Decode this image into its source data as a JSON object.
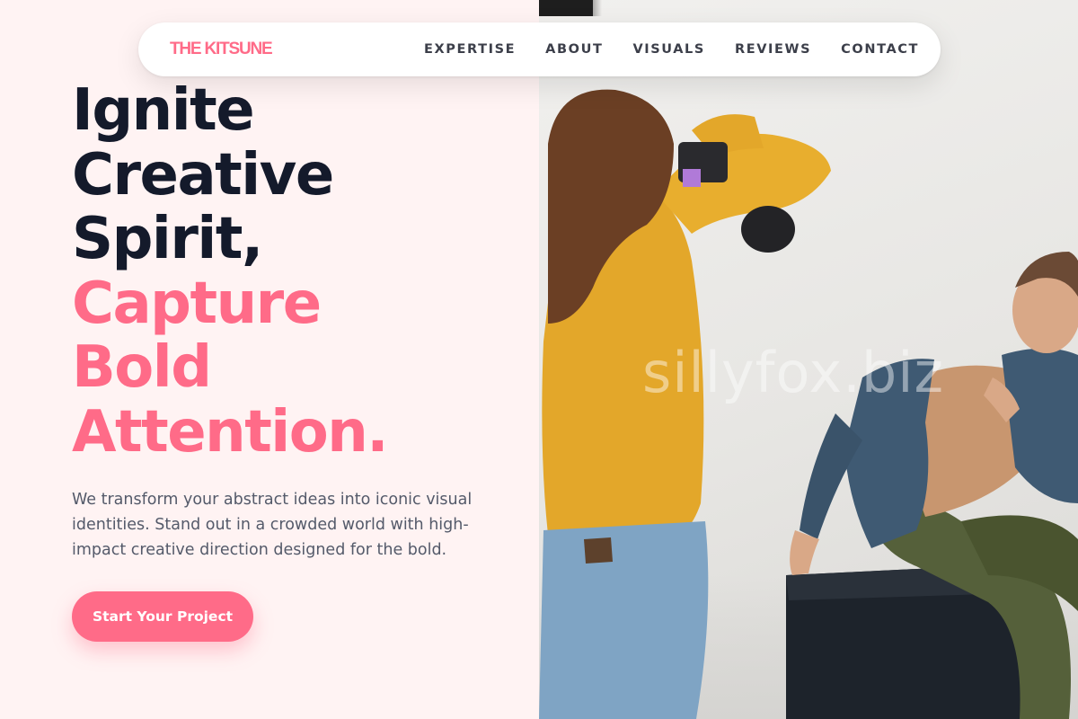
{
  "brand": {
    "name": "THE KITSUNE",
    "color": "#ff6b88"
  },
  "nav": {
    "links": [
      "EXPERTISE",
      "ABOUT",
      "VISUALS",
      "REVIEWS",
      "CONTACT"
    ]
  },
  "hero": {
    "headline_dark": [
      "Ignite",
      "Creative",
      "Spirit,"
    ],
    "headline_pink": [
      "Capture",
      "Bold",
      "Attention."
    ],
    "description": "We transform your abstract ideas into iconic visual identities. Stand out in a crowded world with high-impact creative direction designed for the bold.",
    "cta_label": "Start Your Project"
  },
  "photo": {
    "watermark": "sillyfox.biz"
  },
  "colors": {
    "accent": "#ff6b88",
    "heading": "#141a2b",
    "body_text": "#545a6a",
    "background": "#fff3f3"
  }
}
